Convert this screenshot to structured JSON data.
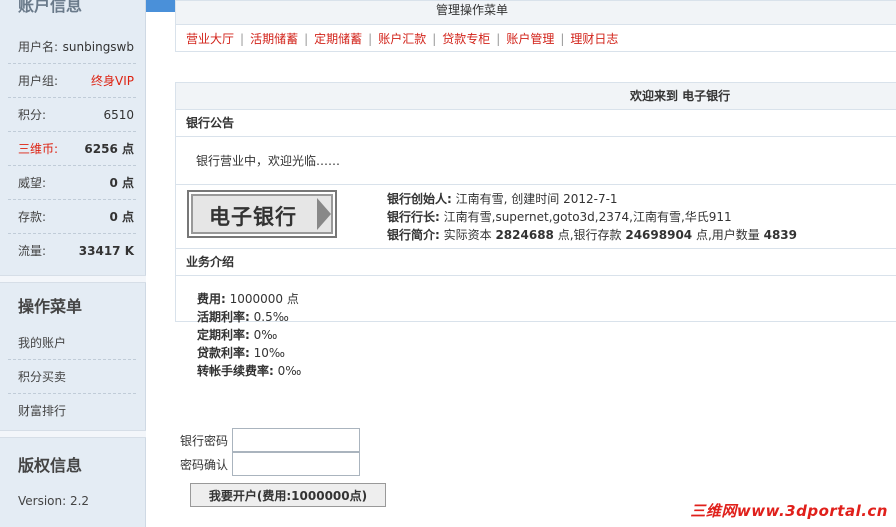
{
  "sidebar": {
    "account_title": "账户信息",
    "rows": [
      {
        "label": "用户名:",
        "value": "sunbingswb"
      },
      {
        "label": "用户组:",
        "value": "终身VIP"
      },
      {
        "label": "积分:",
        "value": "6510"
      },
      {
        "label": "三维币:",
        "value": "6256 点"
      },
      {
        "label": "威望:",
        "value": "0 点"
      },
      {
        "label": "存款:",
        "value": "0 点"
      },
      {
        "label": "流量:",
        "value": "33417 K"
      }
    ],
    "menu_title": "操作菜单",
    "menu_items": [
      "我的账户",
      "积分买卖",
      "财富排行"
    ],
    "copyright_title": "版权信息",
    "version": "Version: 2.2"
  },
  "nav": {
    "header": "管理操作菜单",
    "links": [
      "营业大厅",
      "活期储蓄",
      "定期储蓄",
      "账户汇款",
      "贷款专柜",
      "账户管理",
      "理财日志"
    ]
  },
  "bank": {
    "welcome": "欢迎来到 电子银行",
    "notice_title": "银行公告",
    "notice_text": "银行营业中，欢迎光临……",
    "logo_text": "电子银行",
    "founder_label": "银行创始人:",
    "founder_value": " 江南有雪, 创建时间 2012-7-1",
    "president_label": "银行行长:",
    "president_value": " 江南有雪,supernet,goto3d,2374,江南有雪,华氏911",
    "intro_label": "银行简介:",
    "intro_capital_pre": " 实际资本 ",
    "intro_capital": "2824688",
    "intro_deposit_pre": " 点,银行存款 ",
    "intro_deposit": "24698904",
    "intro_users_pre": " 点,用户数量 ",
    "intro_users": "4839",
    "business_title": "业务介绍",
    "business": [
      {
        "label": "费用:",
        "value": " 1000000 点"
      },
      {
        "label": "活期利率:",
        "value": " 0.5‰"
      },
      {
        "label": "定期利率:",
        "value": " 0‰"
      },
      {
        "label": "贷款利率:",
        "value": " 10‰"
      },
      {
        "label": "转帐手续费率:",
        "value": " 0‰"
      }
    ]
  },
  "form": {
    "password_label": "银行密码",
    "confirm_label": "密码确认",
    "submit_label": "我要开户(费用:1000000点)"
  },
  "watermark": "三维网www.3dportal.cn"
}
